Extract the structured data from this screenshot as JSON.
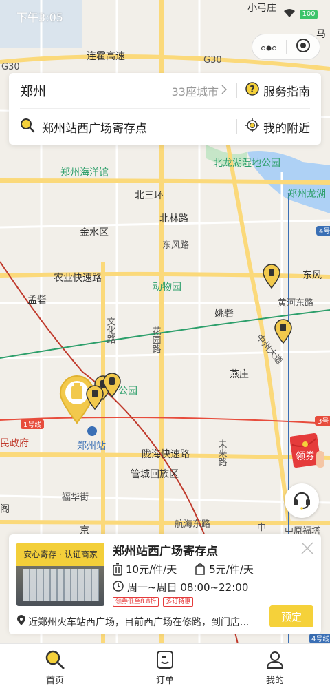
{
  "status": {
    "time": "下午3:05",
    "battery": "100"
  },
  "search": {
    "city": "郑州",
    "city_count": "33座城市",
    "guide_label": "服务指南",
    "query": "郑州站西广场寄存点",
    "nearby_label": "我的附近"
  },
  "map": {
    "labels": {
      "xiaogongzhuang": "小弓庄",
      "ma": "马",
      "lianhuo": "连霍高速",
      "g30a": "G30",
      "g30b": "G30",
      "haiyangguan": "郑州海洋馆",
      "beilonghu": "北龙湖湿地公园",
      "longhu": "郑州龙湖",
      "beisanhuan": "北三环",
      "beilinlu": "北林路",
      "jinshui": "金水区",
      "dongfenglu": "东风路",
      "dongfeng2": "东风",
      "nongye": "农业快速路",
      "dongwuyuan": "动物园",
      "mengyan": "孟砦",
      "wenhualu": "文化路",
      "yaoyan": "姚砦",
      "huanghe": "黄河东路",
      "huayuanlu": "花园路",
      "zhongzhou": "中州大道",
      "yanzhuang": "燕庄",
      "gongyuan": "公园",
      "line1": "1号线",
      "line3": "3号",
      "line4a": "4号",
      "line4b": "4号线",
      "zhengfu": "民政府",
      "zhengzhouzhan": "郑州站",
      "weilailu": "未来路",
      "longhaikuai": "陇海快速路",
      "guancheng": "管城回族区",
      "fuhuajie": "福华街",
      "hanghai": "航海东路",
      "ge": "阁",
      "jing": "京",
      "zhongyuan": "中原福塔",
      "zhong2": "中"
    }
  },
  "coupon": {
    "label": "领券"
  },
  "card": {
    "thumb_banner": "安心寄存 · 认证商家",
    "name": "郑州站西广场寄存点",
    "price_large": "10元/件/天",
    "price_small": "5元/件/天",
    "hours": "周一~周日 08:00~22:00",
    "tags": [
      "领券低至8.8折",
      "多订特惠"
    ],
    "address": "近郑州火车站西广场，目前西广场在修路，到门店...",
    "book_label": "预定"
  },
  "tabs": [
    {
      "label": "首页",
      "icon": "search-icon"
    },
    {
      "label": "订单",
      "icon": "order-icon"
    },
    {
      "label": "我的",
      "icon": "user-icon"
    }
  ],
  "colors": {
    "accent": "#f5d13a",
    "pin": "#f2c94c",
    "red": "#e53b3b"
  }
}
